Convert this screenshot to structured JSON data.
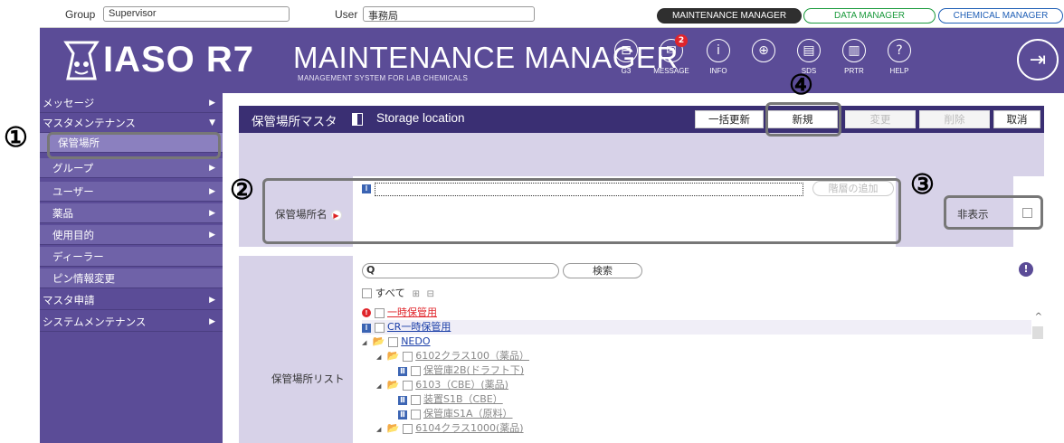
{
  "topbar": {
    "group_label": "Group",
    "group_value": "Supervisor",
    "user_label": "User",
    "user_value": "事務局",
    "managers": [
      {
        "label": "MAINTENANCE MANAGER",
        "active": true
      },
      {
        "label": "DATA MANAGER",
        "active": false
      },
      {
        "label": "CHEMICAL MANAGER",
        "active": false
      }
    ]
  },
  "header": {
    "logo": "IASO R7",
    "title": "MAINTENANCE MANAGER",
    "subtitle": "MANAGEMENT SYSTEM FOR LAB CHEMICALS",
    "icons": [
      {
        "icon": "g3-icon",
        "caption": "G3"
      },
      {
        "icon": "message-icon",
        "caption": "MESSAGE",
        "badge": "2"
      },
      {
        "icon": "info-icon",
        "caption": "INFO"
      },
      {
        "icon": "globe-icon",
        "caption": ""
      },
      {
        "icon": "sds-icon",
        "caption": "SDS"
      },
      {
        "icon": "prtr-icon",
        "caption": "PRTR"
      },
      {
        "icon": "help-icon",
        "caption": "HELP"
      }
    ]
  },
  "sidebar": {
    "items": [
      {
        "label": "メッセージ",
        "arrow": "▶"
      },
      {
        "label": "マスタメンテナンス",
        "arrow": "▼"
      },
      {
        "label": "保管場所",
        "arrow": ""
      },
      {
        "label": "グループ",
        "arrow": "▶"
      },
      {
        "label": "ユーザー",
        "arrow": "▶"
      },
      {
        "label": "薬品",
        "arrow": "▶"
      },
      {
        "label": "使用目的",
        "arrow": "▶"
      },
      {
        "label": "ディーラー",
        "arrow": ""
      },
      {
        "label": "ピン情報変更",
        "arrow": ""
      },
      {
        "label": "マスタ申請",
        "arrow": "▶"
      },
      {
        "label": "システムメンテナンス",
        "arrow": "▶"
      }
    ]
  },
  "page": {
    "title": "保管場所マスタ",
    "title_en": "Storage location",
    "toolbar": {
      "bulk_update": "一括更新",
      "new": "新規",
      "change": "変更",
      "delete": "削除",
      "cancel": "取消"
    }
  },
  "form": {
    "name_label": "保管場所名",
    "name_value": "",
    "add_level": "階層の追加",
    "hide_label": "非表示"
  },
  "list": {
    "label": "保管場所リスト",
    "search_placeholder": "",
    "search_button": "検索",
    "select_all": "すべて",
    "tree": [
      {
        "text": "一時保管用",
        "style": "red",
        "marker": "error"
      },
      {
        "text": "CR一時保管用",
        "style": "blue",
        "marker": "info"
      },
      {
        "text": "NEDO",
        "style": "blue",
        "marker": "folder"
      },
      {
        "text": "6102クラス100（薬品）",
        "style": "gray",
        "marker": "folder"
      },
      {
        "text": "保管庫2B(ドラフト下)",
        "style": "gray",
        "marker": "shelf"
      },
      {
        "text": "6103（CBE）(薬品)",
        "style": "gray",
        "marker": "folder"
      },
      {
        "text": "装置S1B（CBE）",
        "style": "gray",
        "marker": "shelf"
      },
      {
        "text": "保管庫S1A（原料）",
        "style": "gray",
        "marker": "shelf"
      },
      {
        "text": "6104クラス1000(薬品)",
        "style": "gray",
        "marker": "folder"
      }
    ]
  },
  "callouts": [
    "①",
    "②",
    "③",
    "④"
  ]
}
